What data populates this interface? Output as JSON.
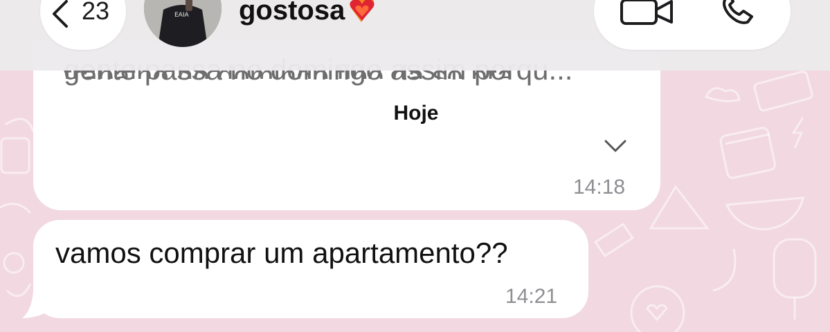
{
  "header": {
    "back_count": "23",
    "contact_name": "gostosa",
    "avatar_label": "EAIA"
  },
  "date_separator": "Hoje",
  "messages": [
    {
      "line_partial": "trabalho no domingo tipo da só pra",
      "text": "gente passa no domingo assim porqu...",
      "time": "14:18",
      "expandable": true
    },
    {
      "text": "vamos comprar um apartamento??",
      "time": "14:21"
    }
  ],
  "colors": {
    "background": "#f2d8e1",
    "bubble": "#ffffff",
    "header": "#eceaec"
  }
}
